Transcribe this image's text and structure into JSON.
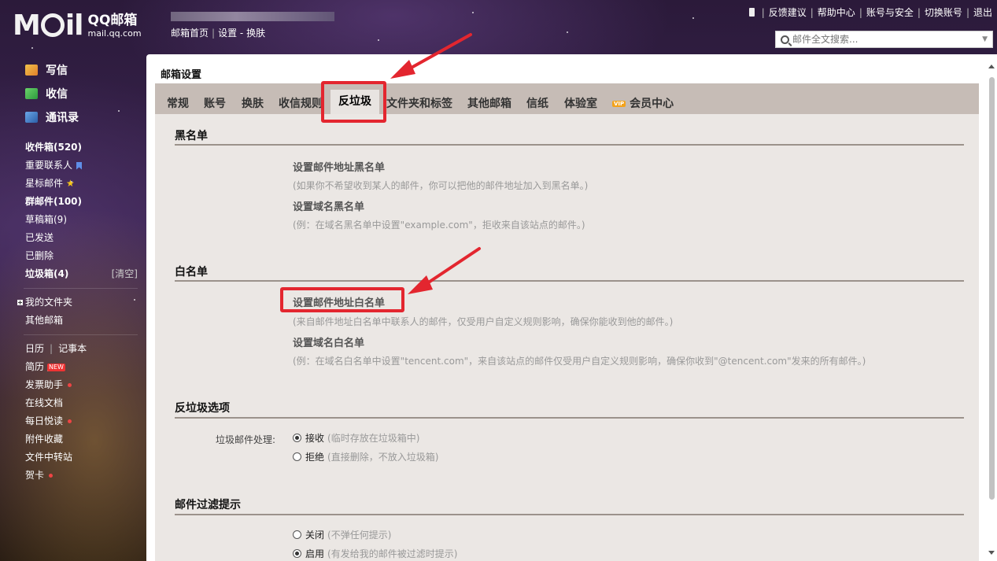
{
  "brand": {
    "logo_text": "Mail",
    "name": "QQ邮箱",
    "domain": "mail.qq.com"
  },
  "topnav": {
    "home": "邮箱首页",
    "settings": "设置",
    "dash": "-",
    "skin": "换肤"
  },
  "toplinks": {
    "feedback": "反馈建议",
    "help": "帮助中心",
    "security": "账号与安全",
    "switch": "切换账号",
    "logout": "退出"
  },
  "search": {
    "placeholder": "邮件全文搜索..."
  },
  "sidebar": {
    "write": "写信",
    "receive": "收信",
    "contacts": "通讯录",
    "inbox": "收件箱(520)",
    "important": "重要联系人",
    "starred": "星标邮件",
    "group": "群邮件(100)",
    "drafts": "草稿箱(9)",
    "sent": "已发送",
    "deleted": "已删除",
    "spam": "垃圾箱(4)",
    "spam_clear": "[清空]",
    "my_folders": "我的文件夹",
    "other_mail": "其他邮箱",
    "calendar": "日历",
    "notes": "记事本",
    "resume": "简历",
    "resume_badge": "NEW",
    "invoice": "发票助手",
    "docs": "在线文档",
    "daily": "每日悦读",
    "attachments": "附件收藏",
    "transfer": "文件中转站",
    "cards": "贺卡"
  },
  "main": {
    "title": "邮箱设置",
    "tabs": [
      "常规",
      "账号",
      "换肤",
      "收信规则",
      "反垃圾",
      "文件夹和标签",
      "其他邮箱",
      "信纸",
      "体验室",
      "会员中心"
    ],
    "vip_badge": "VIP",
    "blacklist": {
      "title": "黑名单",
      "addr_link": "设置邮件地址黑名单",
      "addr_desc": "(如果你不希望收到某人的邮件，你可以把他的邮件地址加入到黑名单。)",
      "domain_link": "设置域名黑名单",
      "domain_desc": "(例：在域名黑名单中设置\"example.com\"，拒收来自该站点的邮件。)"
    },
    "whitelist": {
      "title": "白名单",
      "addr_link": "设置邮件地址白名单",
      "addr_desc": "(来自邮件地址白名单中联系人的邮件，仅受用户自定义规则影响，确保你能收到他的邮件。)",
      "domain_link": "设置域名白名单",
      "domain_desc": "(例：在域名白名单中设置\"tencent.com\"，来自该站点的邮件仅受用户自定义规则影响，确保你收到\"@tencent.com\"发来的所有邮件。)"
    },
    "antispam": {
      "title": "反垃圾选项",
      "label": "垃圾邮件处理:",
      "accept": "接收",
      "accept_hint": "(临时存放在垃圾箱中)",
      "reject": "拒绝",
      "reject_hint": "(直接删除，不放入垃圾箱)"
    },
    "filter": {
      "title": "邮件过滤提示",
      "off": "关闭",
      "off_hint": "(不弹任何提示)",
      "on": "启用",
      "on_hint": "(有发给我的邮件被过滤时提示)"
    }
  },
  "colors": {
    "annotation_red": "#e3262f",
    "tabbar_bg": "#c6bcb6",
    "content_bg": "#ebe7e4"
  }
}
